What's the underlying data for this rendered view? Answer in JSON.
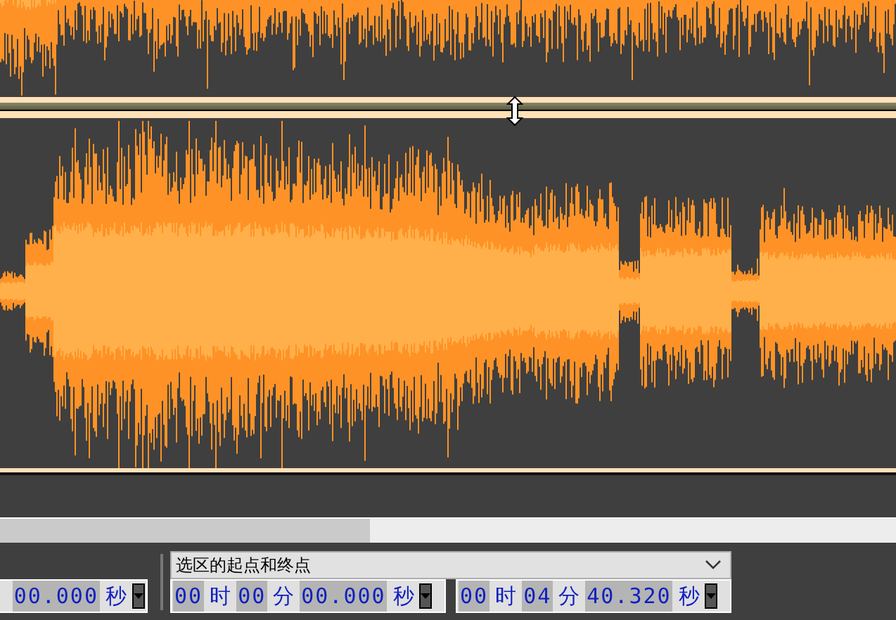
{
  "selection_toolbar": {
    "mode_dropdown": {
      "value": "选区的起点和终点"
    },
    "time_fields": [
      {
        "parts": [
          {
            "kind": "digits",
            "text": "00.000"
          },
          {
            "kind": "unit",
            "text": "秒"
          }
        ]
      },
      {
        "parts": [
          {
            "kind": "digits",
            "text": "00"
          },
          {
            "kind": "unit",
            "text": "时"
          },
          {
            "kind": "digits",
            "text": "00"
          },
          {
            "kind": "unit",
            "text": "分"
          },
          {
            "kind": "digits",
            "text": "00.000"
          },
          {
            "kind": "unit",
            "text": "秒"
          }
        ]
      },
      {
        "parts": [
          {
            "kind": "digits",
            "text": "00"
          },
          {
            "kind": "unit",
            "text": "时"
          },
          {
            "kind": "digits",
            "text": "04"
          },
          {
            "kind": "unit",
            "text": "分"
          },
          {
            "kind": "digits",
            "text": "40.320"
          },
          {
            "kind": "unit",
            "text": "秒"
          }
        ]
      }
    ]
  }
}
